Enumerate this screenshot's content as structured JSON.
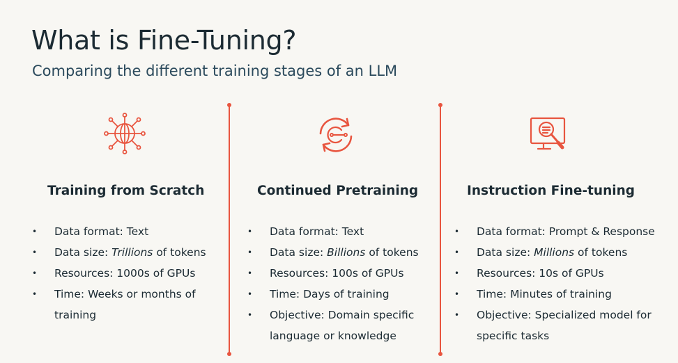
{
  "header": {
    "title": "What is Fine-Tuning?",
    "subtitle": "Comparing the different training stages of an LLM"
  },
  "accent_color": "#e8553f",
  "columns": [
    {
      "icon": "globe-network-icon",
      "heading": "Training from Scratch",
      "items": [
        {
          "lines": [
            "Data format: Text"
          ]
        },
        {
          "pre": "Data size: ",
          "em": "Trillions",
          "post": " of tokens"
        },
        {
          "lines": [
            "Resources: 1000s of GPUs"
          ]
        },
        {
          "lines": [
            "Time: Weeks or months of",
            "training"
          ]
        }
      ]
    },
    {
      "icon": "refresh-cycle-icon",
      "heading": "Continued Pretraining",
      "items": [
        {
          "lines": [
            "Data format: Text"
          ]
        },
        {
          "pre": "Data size: ",
          "em": "Billions",
          "post": " of tokens"
        },
        {
          "lines": [
            "Resources: 100s of GPUs"
          ]
        },
        {
          "lines": [
            "Time: Days of training"
          ]
        },
        {
          "lines": [
            "Objective: Domain specific",
            "language or knowledge"
          ]
        }
      ]
    },
    {
      "icon": "monitor-search-icon",
      "heading": "Instruction Fine-tuning",
      "items": [
        {
          "lines": [
            "Data format: Prompt & Response"
          ]
        },
        {
          "pre": "Data size: ",
          "em": "Millions",
          "post": " of tokens"
        },
        {
          "lines": [
            "Resources: 10s of GPUs"
          ]
        },
        {
          "lines": [
            "Time: Minutes of training"
          ]
        },
        {
          "lines": [
            "Objective: Specialized model for",
            "specific tasks"
          ]
        }
      ]
    }
  ]
}
